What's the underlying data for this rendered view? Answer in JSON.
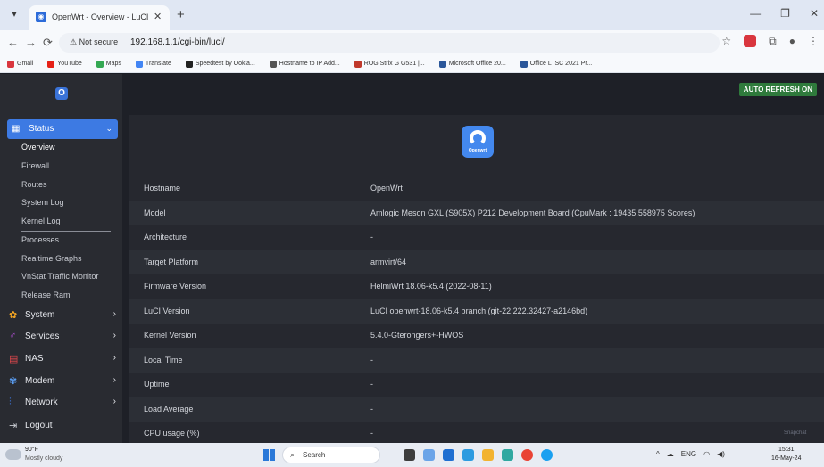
{
  "browser": {
    "tab_title": "OpenWrt - Overview - LuCI",
    "tab_close": "✕",
    "new_tab": "+",
    "security_label": "⚠ Not secure",
    "url": "192.168.1.1/cgi-bin/luci/",
    "bookmarks": [
      {
        "label": "Gmail",
        "color": "#d9363e"
      },
      {
        "label": "YouTube",
        "color": "#e62117"
      },
      {
        "label": "Maps",
        "color": "#34a853"
      },
      {
        "label": "Translate",
        "color": "#4285f4"
      },
      {
        "label": "Speedtest by Ookla...",
        "color": "#222222"
      },
      {
        "label": "Hostname to IP Add...",
        "color": "#555555"
      },
      {
        "label": "ROG Strix G G531 |...",
        "color": "#c0392b"
      },
      {
        "label": "Microsoft Office 20...",
        "color": "#2b579a"
      },
      {
        "label": "Office LTSC 2021 Pr...",
        "color": "#2b579a"
      }
    ]
  },
  "sidebar": {
    "logo": "O",
    "status_label": "Status",
    "status_subitems": [
      "Overview",
      "Firewall",
      "Routes",
      "System Log",
      "Kernel Log",
      "Processes",
      "Realtime Graphs",
      "VnStat Traffic Monitor",
      "Release Ram"
    ],
    "items": [
      {
        "label": "System",
        "icon": "gear-icon",
        "color": "#f5a623"
      },
      {
        "label": "Services",
        "icon": "services-icon",
        "color": "#b14fd6"
      },
      {
        "label": "NAS",
        "icon": "storage-icon",
        "color": "#e5484d"
      },
      {
        "label": "Modem",
        "icon": "modem-icon",
        "color": "#5a9cf0"
      },
      {
        "label": "Network",
        "icon": "network-icon",
        "color": "#3d7ae3"
      },
      {
        "label": "Logout",
        "icon": "logout-icon",
        "color": "#c8cbd2"
      }
    ]
  },
  "main": {
    "auto_refresh": "AUTO REFRESH ON",
    "openwrt_logo_text": "Openwrt",
    "rows": [
      {
        "key": "Hostname",
        "value": "OpenWrt"
      },
      {
        "key": "Model",
        "value": "Amlogic Meson GXL (S905X) P212 Development Board (CpuMark : 19435.558975 Scores)"
      },
      {
        "key": "Architecture",
        "value": "-"
      },
      {
        "key": "Target Platform",
        "value": "armvirt/64"
      },
      {
        "key": "Firmware Version",
        "value": "HelmiWrt 18.06-k5.4 (2022-08-11)"
      },
      {
        "key": "LuCI Version",
        "value": "LuCI openwrt-18.06-k5.4 branch (git-22.222.32427-a2146bd)"
      },
      {
        "key": "Kernel Version",
        "value": "5.4.0-Gterongers+-HWOS"
      },
      {
        "key": "Local Time",
        "value": "-"
      },
      {
        "key": "Uptime",
        "value": "-"
      },
      {
        "key": "Load Average",
        "value": "-"
      },
      {
        "key": "CPU usage (%)",
        "value": "-"
      }
    ]
  },
  "taskbar": {
    "temp": "90°F",
    "weather": "Mostly cloudy",
    "search_label": "Search",
    "lang": "ENG",
    "time": "15:31",
    "date": "16-May-24",
    "snap": "Snapchat"
  }
}
